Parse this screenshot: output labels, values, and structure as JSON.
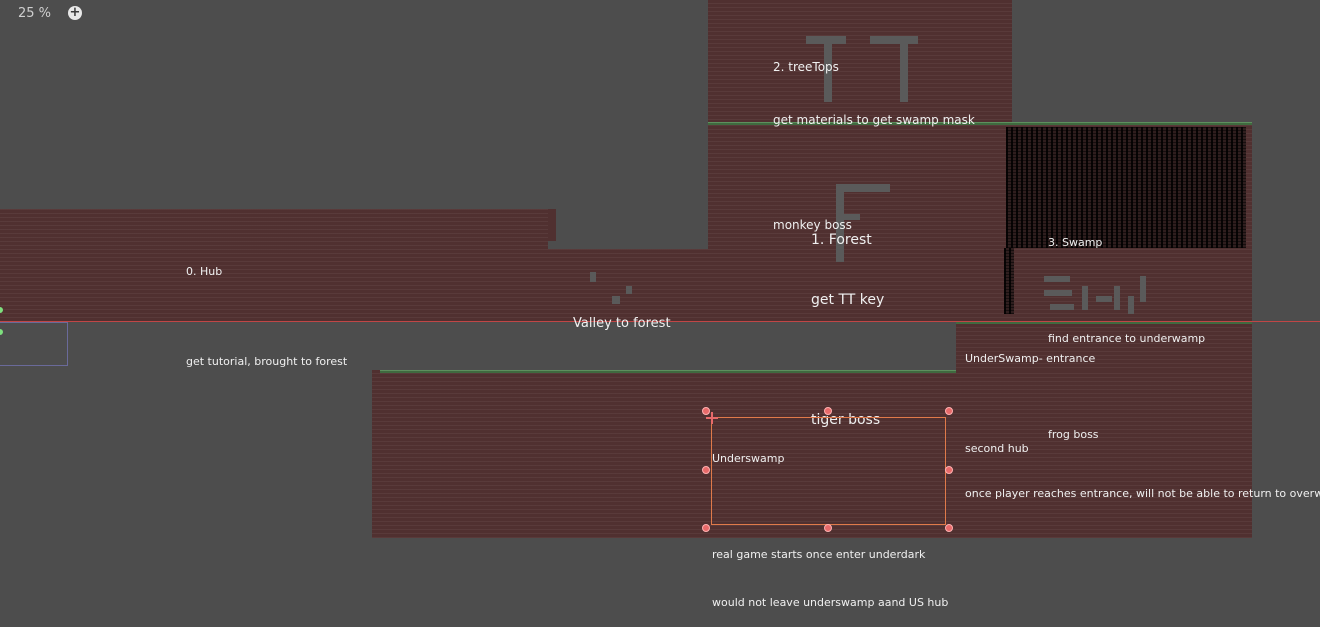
{
  "editor": {
    "zoom_label": "25 %",
    "zoom_in_icon": "plus-circle-icon"
  },
  "rooms": [
    {
      "id": "hub",
      "lines": [
        "0. Hub",
        "",
        "get tutorial, brought to forest"
      ]
    },
    {
      "id": "valley",
      "lines": [
        "Valley to forest"
      ]
    },
    {
      "id": "forest",
      "lines": [
        "1. Forest",
        "get TT key",
        "",
        "tiger boss"
      ]
    },
    {
      "id": "treetops",
      "lines": [
        "2. treeTops",
        "get materials to get swamp mask",
        "",
        "monkey boss"
      ]
    },
    {
      "id": "swamp",
      "lines": [
        "3. Swamp",
        "",
        "find entrance to underwamp",
        "",
        "frog boss"
      ]
    },
    {
      "id": "underswamp-entrance",
      "lines": [
        "UnderSwamp- entrance",
        "",
        "second hub",
        "once player reaches entrance, will not be able to return to overworld"
      ]
    },
    {
      "id": "underswamp",
      "lines": [
        "Underswamp",
        "",
        "real game starts once enter underdark",
        "would not leave underswamp aand US hub"
      ]
    }
  ],
  "colors": {
    "canvas_bg": "#4d4d4d",
    "wall": "#503030",
    "selection": "#e07a4a",
    "handle": "#e86a6a",
    "limit_line": "#c04646",
    "grass": "#3f6a3f",
    "anchor": "#7ee07e"
  }
}
